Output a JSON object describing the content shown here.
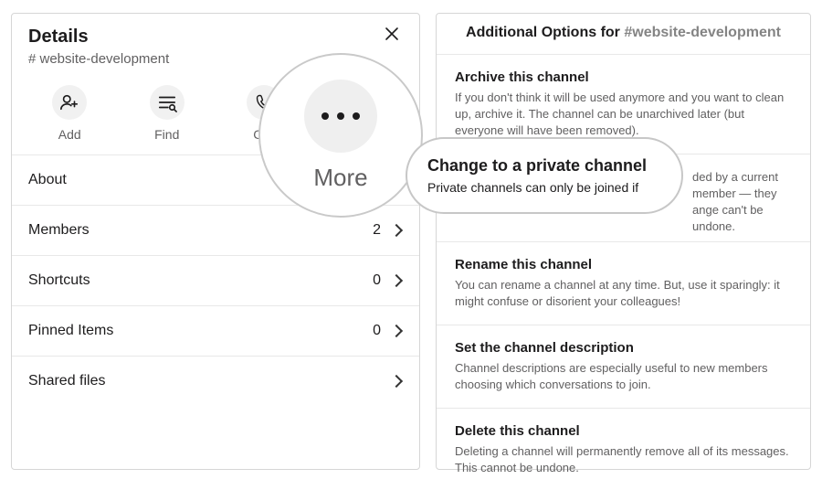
{
  "details": {
    "title": "Details",
    "channel": "# website-development",
    "actions": {
      "add": "Add",
      "find": "Find",
      "call": "Call",
      "more": "More"
    },
    "rows": {
      "about": "About",
      "members": {
        "label": "Members",
        "count": 2
      },
      "shortcuts": {
        "label": "Shortcuts",
        "count": 0
      },
      "pinned": {
        "label": "Pinned Items",
        "count": 0
      },
      "shared": "Shared files"
    }
  },
  "magnifier": {
    "label": "More"
  },
  "options_panel": {
    "title_prefix": "Additional Options for ",
    "channel": "#website-development",
    "archive": {
      "title": "Archive this channel",
      "desc": "If you don't think it will be used anymore and you want to clean up, archive it. The channel can be unarchived later (but everyone will have been removed)."
    },
    "private": {
      "title": "Change to a private channel",
      "desc_visible": "ded by a current member — they   ange can't be undone."
    },
    "rename": {
      "title": "Rename this channel",
      "desc": "You can rename a channel at any time. But, use it sparingly: it might confuse or disorient your colleagues!"
    },
    "setdesc": {
      "title": "Set the channel description",
      "desc": "Channel descriptions are especially useful to new members choosing which conversations to join."
    },
    "delete": {
      "title": "Delete this channel",
      "desc": "Deleting a channel will permanently remove all of its messages. This cannot be undone."
    }
  },
  "highlight": {
    "title": "Change to a private channel",
    "desc": "Private channels can only be joined if"
  }
}
